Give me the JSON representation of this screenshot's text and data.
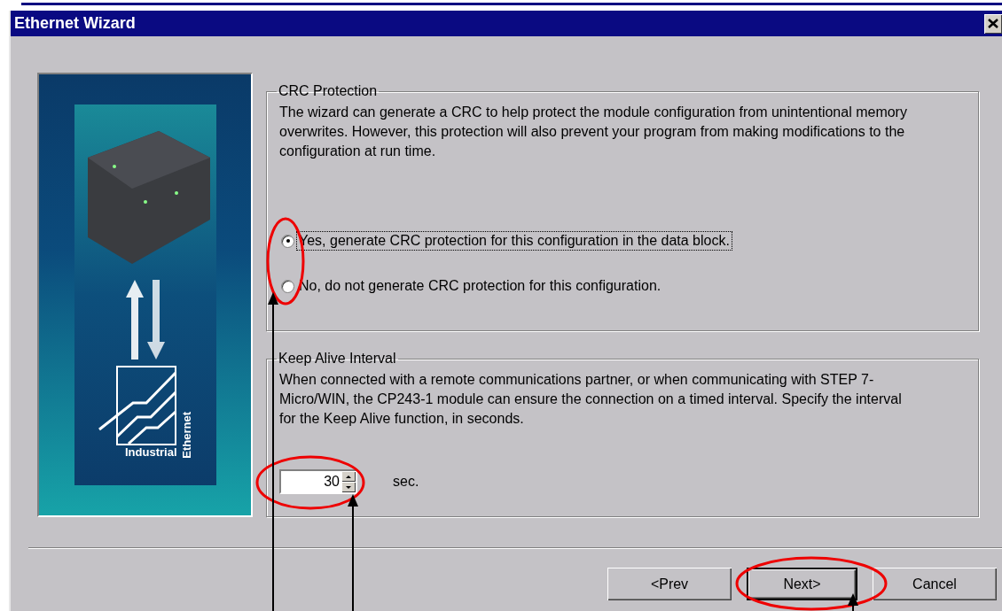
{
  "window": {
    "title": "Ethernet Wizard"
  },
  "banner": {
    "logo_texts": [
      "Industrial",
      "Ethernet"
    ]
  },
  "crc_protection": {
    "title": "CRC Protection",
    "description": "The wizard can generate a CRC to help protect the module configuration from unintentional memory overwrites. However, this protection will also prevent your program from making modifications to the configuration at run time.",
    "options": [
      {
        "label": "Yes, generate CRC protection for this configuration in the data block.",
        "selected": true,
        "focused": true
      },
      {
        "label": "No, do not generate CRC protection for this configuration.",
        "selected": false,
        "focused": false
      }
    ]
  },
  "keep_alive": {
    "title": "Keep Alive Interval",
    "description": "When connected with a remote communications partner, or when communicating with STEP 7-Micro/WIN, the CP243-1 module can ensure the connection on a timed interval. Specify the interval for the Keep Alive function, in seconds.",
    "value": "30",
    "unit": "sec."
  },
  "buttons": [
    {
      "label": "<Prev",
      "default": false
    },
    {
      "label": "Next>",
      "default": true
    },
    {
      "label": "Cancel",
      "default": false
    }
  ]
}
